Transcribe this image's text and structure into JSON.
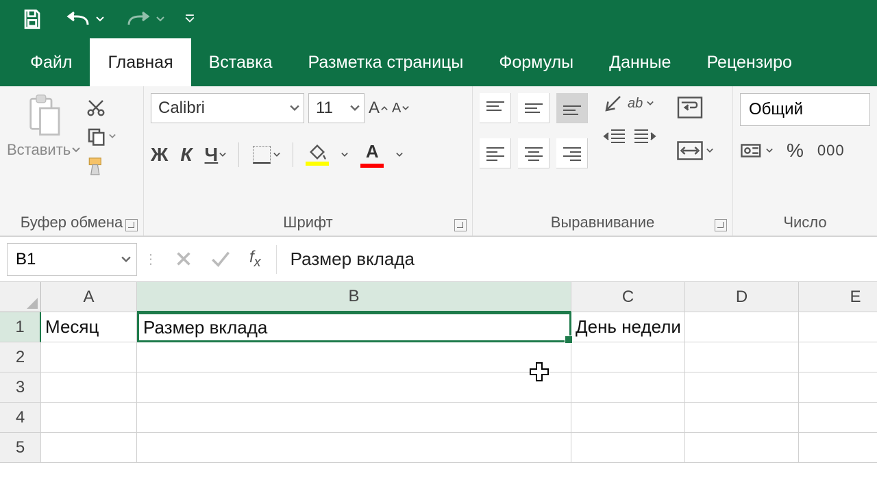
{
  "qat": {
    "save": "save-icon",
    "undo": "undo-icon",
    "redo": "redo-icon"
  },
  "tabs": {
    "items": [
      {
        "label": "Файл",
        "active": false
      },
      {
        "label": "Главная",
        "active": true
      },
      {
        "label": "Вставка",
        "active": false
      },
      {
        "label": "Разметка страницы",
        "active": false
      },
      {
        "label": "Формулы",
        "active": false
      },
      {
        "label": "Данные",
        "active": false
      },
      {
        "label": "Рецензиро",
        "active": false
      }
    ]
  },
  "ribbon": {
    "clipboard": {
      "paste_label": "Вставить",
      "group_label": "Буфер обмена"
    },
    "font": {
      "font_name": "Calibri",
      "font_size": "11",
      "bold": "Ж",
      "italic": "К",
      "underline": "Ч",
      "group_label": "Шрифт"
    },
    "alignment": {
      "group_label": "Выравнивание"
    },
    "number": {
      "format": "Общий",
      "percent": "%",
      "thousands": "000",
      "group_label": "Число"
    }
  },
  "formula_bar": {
    "name_box": "B1",
    "fx_label": "fx",
    "content": "Размер вклада"
  },
  "sheet": {
    "columns": [
      "A",
      "B",
      "C",
      "D",
      "E"
    ],
    "rows": [
      "1",
      "2",
      "3",
      "4",
      "5"
    ],
    "selected_col": "B",
    "selected_row": "1",
    "cells": {
      "A1": "Месяц",
      "B1": "Размер вклада",
      "C1": "День недели"
    }
  }
}
